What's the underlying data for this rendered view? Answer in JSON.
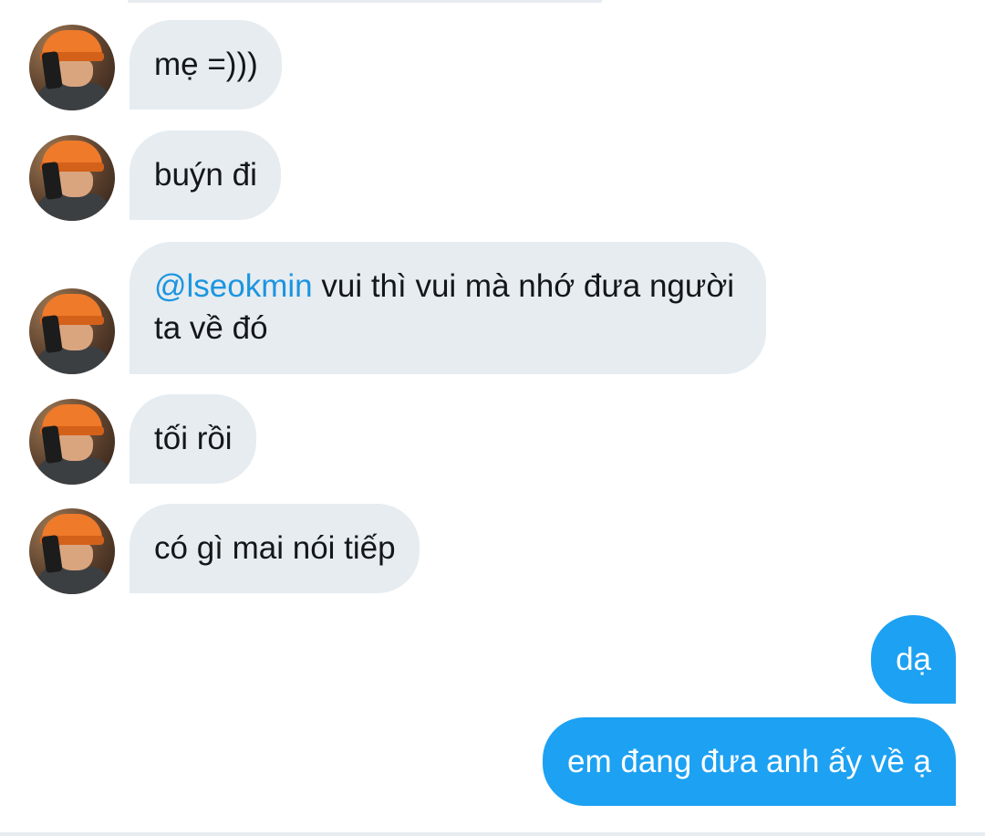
{
  "conversation": {
    "messages": [
      {
        "direction": "incoming",
        "text": "mẹ =)))"
      },
      {
        "direction": "incoming",
        "text": "buýn đi"
      },
      {
        "direction": "incoming",
        "mention": "@lseokmin",
        "text": " vui thì vui mà nhớ đưa người ta về đó"
      },
      {
        "direction": "incoming",
        "text": "tối rồi"
      },
      {
        "direction": "incoming",
        "text": "có gì mai nói tiếp"
      },
      {
        "direction": "outgoing",
        "text": "dạ"
      },
      {
        "direction": "outgoing",
        "text": "em đang đưa anh ấy về ạ"
      }
    ]
  },
  "colors": {
    "incoming_bubble": "#e6ecf0",
    "outgoing_bubble": "#1da1f2",
    "mention": "#1b95e0",
    "text": "#14171a"
  },
  "icons": {
    "avatar": "user-avatar-orange-beanie"
  }
}
